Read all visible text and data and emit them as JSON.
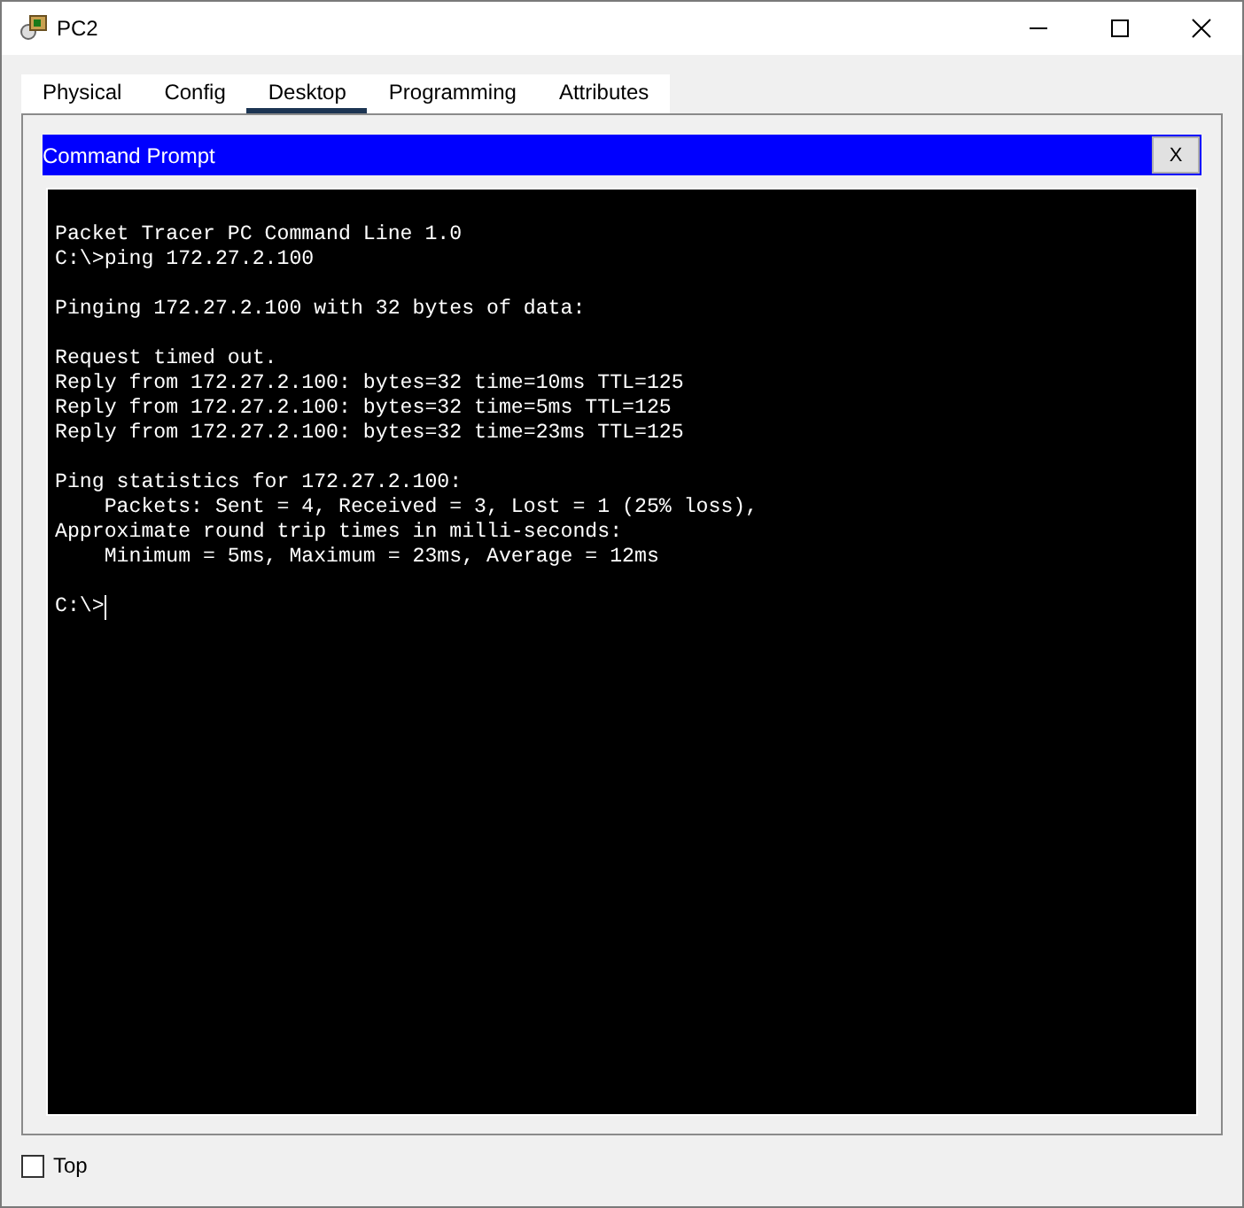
{
  "window": {
    "title": "PC2"
  },
  "tabs": [
    {
      "label": "Physical",
      "selected": false
    },
    {
      "label": "Config",
      "selected": false
    },
    {
      "label": "Desktop",
      "selected": true
    },
    {
      "label": "Programming",
      "selected": false
    },
    {
      "label": "Attributes",
      "selected": false
    }
  ],
  "command_prompt": {
    "title": "Command Prompt",
    "close_label": "X",
    "output": [
      [
        "Packet Tracer PC Command Line 1.0",
        "C:\\>ping 172.27.2.100"
      ],
      [
        "Pinging 172.27.2.100 with 32 bytes of data:"
      ],
      [
        "Request timed out.",
        "Reply from 172.27.2.100: bytes=32 time=10ms TTL=125",
        "Reply from 172.27.2.100: bytes=32 time=5ms TTL=125",
        "Reply from 172.27.2.100: bytes=32 time=23ms TTL=125"
      ],
      [
        "Ping statistics for 172.27.2.100:",
        "    Packets: Sent = 4, Received = 3, Lost = 1 (25% loss),",
        "Approximate round trip times in milli-seconds:",
        "    Minimum = 5ms, Maximum = 23ms, Average = 12ms"
      ]
    ],
    "prompt": {
      "text": "C:\\>",
      "cursor": true
    }
  },
  "top_checkbox": {
    "label": "Top",
    "checked": false
  }
}
